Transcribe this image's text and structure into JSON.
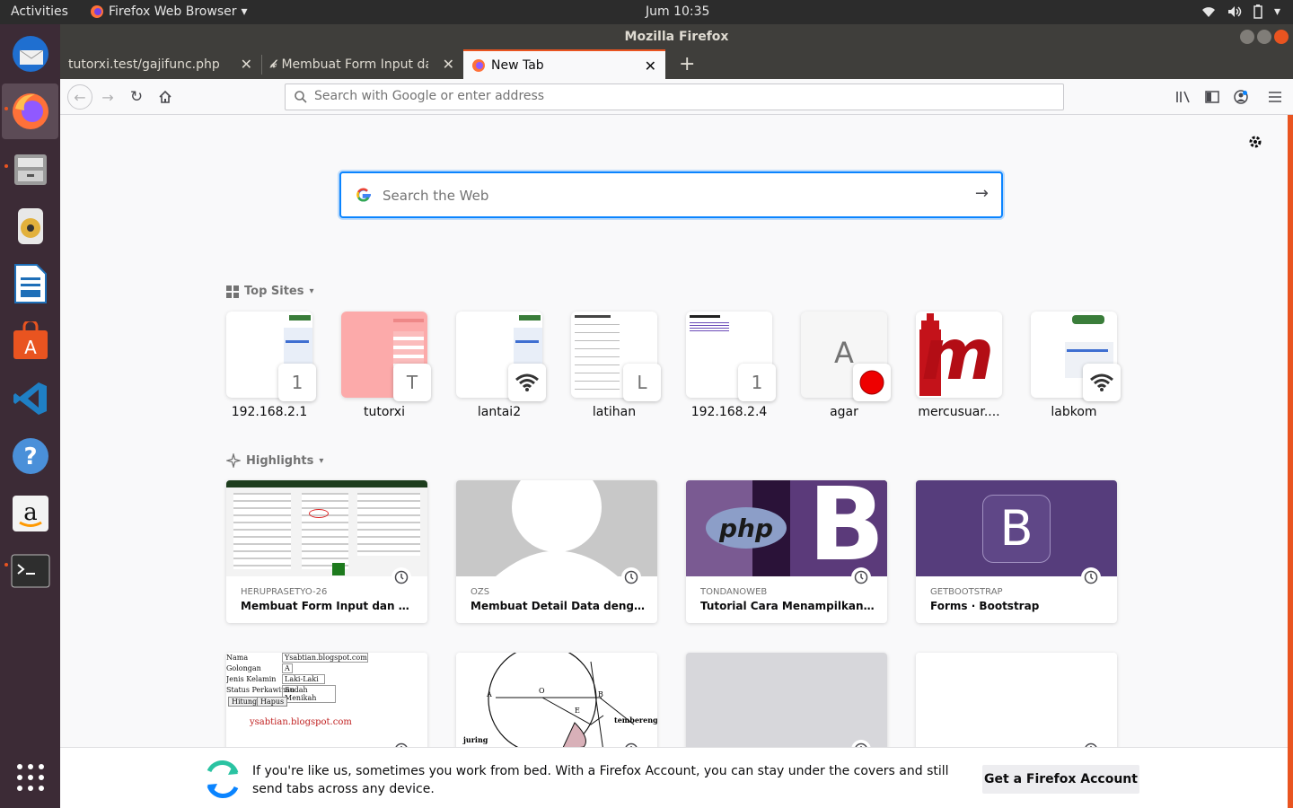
{
  "system_bar": {
    "activities": "Activities",
    "app_name": "Firefox Web Browser",
    "clock": "Jum 10:35"
  },
  "window": {
    "title": "Mozilla Firefox"
  },
  "tabs": [
    {
      "label": "tutorxi.test/gajifunc.php"
    },
    {
      "label": "Membuat Form Input da"
    },
    {
      "label": "New Tab"
    }
  ],
  "urlbar": {
    "placeholder": "Search with Google or enter address"
  },
  "search": {
    "placeholder": "Search the Web"
  },
  "top_sites": {
    "heading": "Top Sites",
    "items": [
      {
        "label": "192.168.2.1",
        "badge": "1"
      },
      {
        "label": "tutorxi",
        "badge": "T"
      },
      {
        "label": "lantai2",
        "badge": ""
      },
      {
        "label": "latihan",
        "badge": "L"
      },
      {
        "label": "192.168.2.4",
        "badge": "1"
      },
      {
        "label": "agar",
        "letter": "A"
      },
      {
        "label": "mercusuar....",
        "logo_text": "m"
      },
      {
        "label": "labkom",
        "badge": ""
      }
    ]
  },
  "highlights": {
    "heading": "Highlights",
    "cards": [
      {
        "source": "HERUPRASETYO-26",
        "title": "Membuat Form Input dan Output..."
      },
      {
        "source": "OZS",
        "title": "Membuat Detail Data dengan Mo..."
      },
      {
        "source": "TONDANOWEB",
        "title": "Tutorial Cara Menampilkan Data..."
      },
      {
        "source": "GETBOOTSTRAP",
        "title": "Forms · Bootstrap"
      }
    ],
    "thumb_texts": {
      "php_logo": "php",
      "bootstrap_b": "B",
      "form_rows": [
        "Nama",
        "Golongan",
        "Jenis Kelamin",
        "Status Perkawinan"
      ],
      "form_values": [
        "Ysabtian.blogspot.com",
        "A",
        "Laki-Laki",
        "Sudah Menikah"
      ],
      "form_buttons": [
        "Hitung",
        "Hapus"
      ],
      "form_footer": "ysabtian.blogspot.com",
      "circle_labels": [
        "A",
        "O",
        "B",
        "E",
        "juring",
        "tembereng"
      ]
    }
  },
  "banner": {
    "text": "If you're like us, sometimes you work from bed. With a Firefox Account, you can stay under the covers and still send tabs across any device.",
    "button": "Get a Firefox Account"
  },
  "colors": {
    "accent": "#e95420",
    "focus": "#0a84ff",
    "bootstrap": "#563d7c"
  }
}
